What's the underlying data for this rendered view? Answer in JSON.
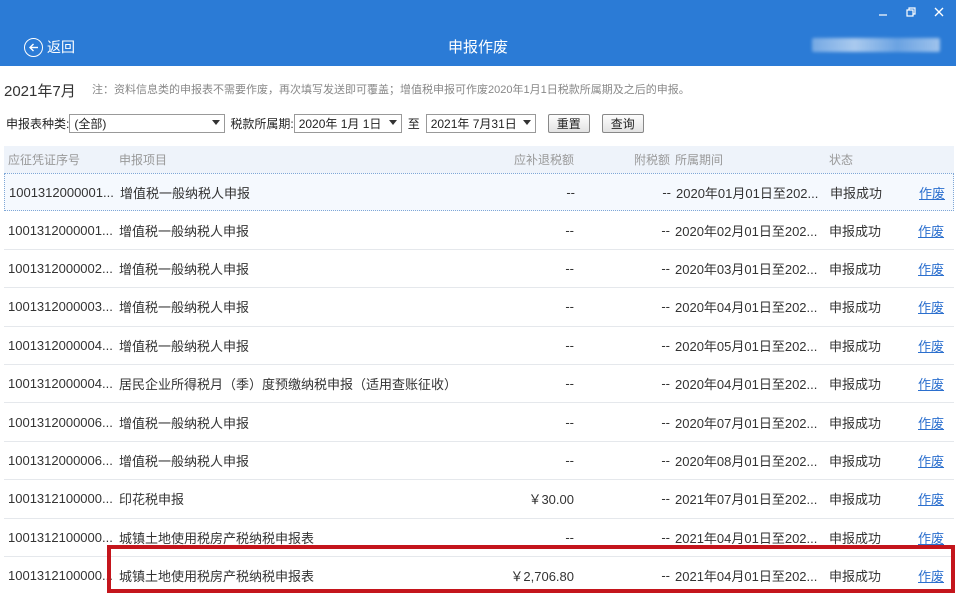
{
  "header": {
    "back_label": "返回",
    "title": "申报作废"
  },
  "period_label": "2021年7月",
  "note": "注：资料信息类的申报表不需要作废，再次填写发送即可覆盖；增值税申报可作废2020年1月1日税款所属期及之后的申报。",
  "filter": {
    "type_label": "申报表种类:",
    "type_value": "(全部)",
    "period_label": "税款所属期:",
    "from_date": "2020年 1月 1日",
    "to_label": "至",
    "to_date": "2021年 7月31日",
    "reset_label": "重置",
    "query_label": "查询"
  },
  "columns": {
    "id": "应征凭证序号",
    "item": "申报项目",
    "amount": "应补退税额",
    "tax": "附税额",
    "period": "所属期间",
    "status": "状态"
  },
  "rows": [
    {
      "id": "1001312000001...",
      "item": "增值税一般纳税人申报",
      "amount": "--",
      "tax": "--",
      "period": "2020年01月01日至202...",
      "status": "申报成功",
      "action": "作废"
    },
    {
      "id": "1001312000001...",
      "item": "增值税一般纳税人申报",
      "amount": "--",
      "tax": "--",
      "period": "2020年02月01日至202...",
      "status": "申报成功",
      "action": "作废"
    },
    {
      "id": "1001312000002...",
      "item": "增值税一般纳税人申报",
      "amount": "--",
      "tax": "--",
      "period": "2020年03月01日至202...",
      "status": "申报成功",
      "action": "作废"
    },
    {
      "id": "1001312000003...",
      "item": "增值税一般纳税人申报",
      "amount": "--",
      "tax": "--",
      "period": "2020年04月01日至202...",
      "status": "申报成功",
      "action": "作废"
    },
    {
      "id": "1001312000004...",
      "item": "增值税一般纳税人申报",
      "amount": "--",
      "tax": "--",
      "period": "2020年05月01日至202...",
      "status": "申报成功",
      "action": "作废"
    },
    {
      "id": "1001312000004...",
      "item": "居民企业所得税月（季）度预缴纳税申报（适用查账征收）",
      "amount": "--",
      "tax": "--",
      "period": "2020年04月01日至202...",
      "status": "申报成功",
      "action": "作废"
    },
    {
      "id": "1001312000006...",
      "item": "增值税一般纳税人申报",
      "amount": "--",
      "tax": "--",
      "period": "2020年07月01日至202...",
      "status": "申报成功",
      "action": "作废"
    },
    {
      "id": "1001312000006...",
      "item": "增值税一般纳税人申报",
      "amount": "--",
      "tax": "--",
      "period": "2020年08月01日至202...",
      "status": "申报成功",
      "action": "作废"
    },
    {
      "id": "1001312100000...",
      "item": "印花税申报",
      "amount": "￥30.00",
      "tax": "--",
      "period": "2021年07月01日至202...",
      "status": "申报成功",
      "action": "作废"
    },
    {
      "id": "1001312100000...",
      "item": "城镇土地使用税房产税纳税申报表",
      "amount": "--",
      "tax": "--",
      "period": "2021年04月01日至202...",
      "status": "申报成功",
      "action": "作废"
    },
    {
      "id": "1001312100000...",
      "item": "城镇土地使用税房产税纳税申报表",
      "amount": "￥2,706.80",
      "tax": "--",
      "period": "2021年04月01日至202...",
      "status": "申报成功",
      "action": "作废"
    }
  ],
  "colors": {
    "header_bg": "#2b7bd6",
    "link": "#2b6fce",
    "highlight": "#c4151c"
  }
}
